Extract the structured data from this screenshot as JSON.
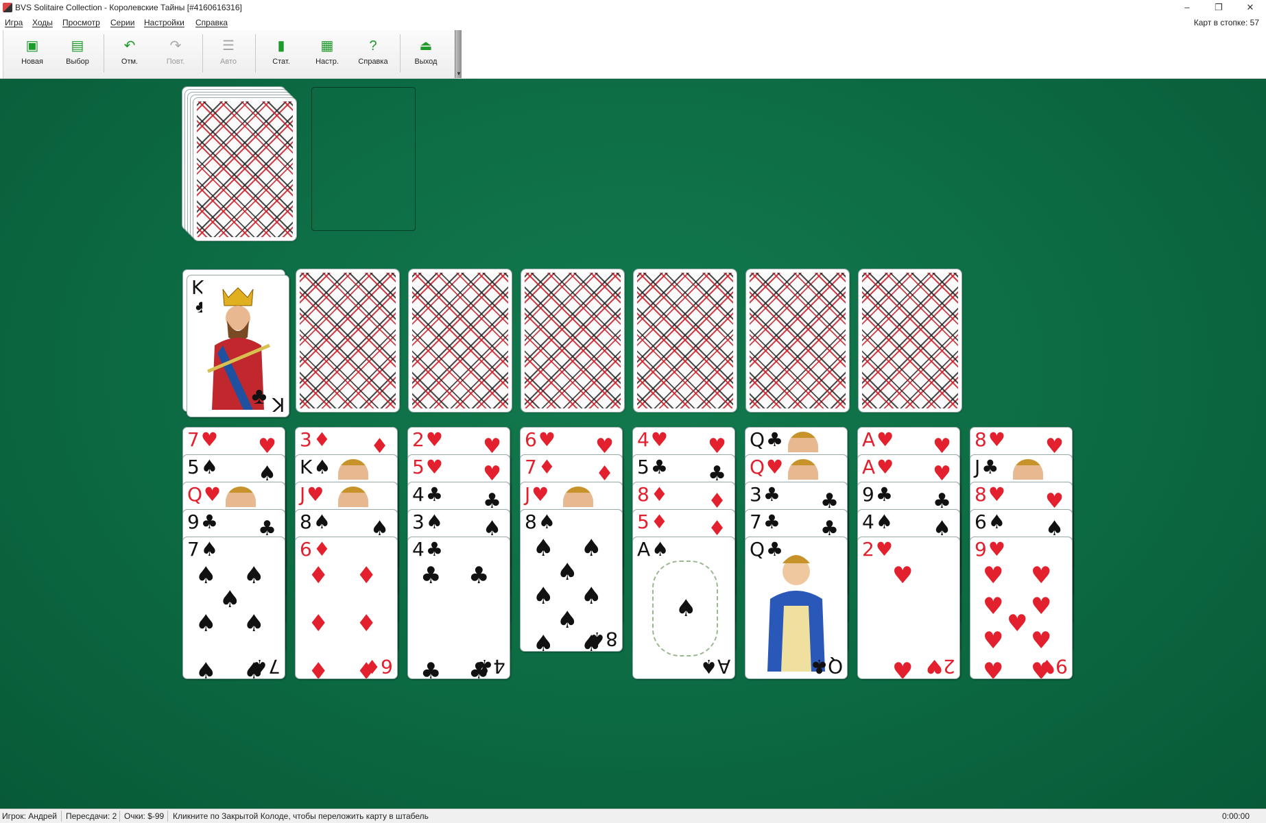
{
  "window": {
    "title": "BVS Solitaire Collection  -  Королевские Тайны [#4160616316]",
    "minimize": "–",
    "restore": "❐",
    "close": "✕"
  },
  "menu": {
    "items": [
      "Игра",
      "Ходы",
      "Просмотр",
      "Серии",
      "Настройки",
      "Справка"
    ],
    "stock_label": "Карт в стопке:  57"
  },
  "toolbar": {
    "new": "Новая",
    "choose": "Выбор",
    "undo": "Отм.",
    "redo": "Повт.",
    "auto": "Авто",
    "stats": "Стат.",
    "settings": "Настр.",
    "help": "Справка",
    "exit": "Выход"
  },
  "colors": {
    "felt": "#0e6a45",
    "red_suit": "#e2202e",
    "black_suit": "#111111",
    "icon_green": "#1e9a2a"
  },
  "board": {
    "reserve": {
      "rank": "K",
      "suit": "♣",
      "color": "black"
    },
    "tableau": [
      {
        "cards": [
          {
            "rank": "7",
            "suit": "♥",
            "color": "red"
          },
          {
            "rank": "5",
            "suit": "♠",
            "color": "black"
          },
          {
            "rank": "Q",
            "suit": "♥",
            "color": "red"
          },
          {
            "rank": "9",
            "suit": "♣",
            "color": "black"
          },
          {
            "rank": "7",
            "suit": "♠",
            "color": "black"
          }
        ]
      },
      {
        "cards": [
          {
            "rank": "3",
            "suit": "♦",
            "color": "red"
          },
          {
            "rank": "K",
            "suit": "♠",
            "color": "black"
          },
          {
            "rank": "J",
            "suit": "♥",
            "color": "red"
          },
          {
            "rank": "8",
            "suit": "♠",
            "color": "black"
          },
          {
            "rank": "6",
            "suit": "♦",
            "color": "red"
          }
        ]
      },
      {
        "cards": [
          {
            "rank": "2",
            "suit": "♥",
            "color": "red"
          },
          {
            "rank": "5",
            "suit": "♥",
            "color": "red"
          },
          {
            "rank": "4",
            "suit": "♣",
            "color": "black"
          },
          {
            "rank": "3",
            "suit": "♠",
            "color": "black"
          },
          {
            "rank": "4",
            "suit": "♣",
            "color": "black"
          }
        ]
      },
      {
        "cards": [
          {
            "rank": "6",
            "suit": "♥",
            "color": "red"
          },
          {
            "rank": "7",
            "suit": "♦",
            "color": "red"
          },
          {
            "rank": "J",
            "suit": "♥",
            "color": "red"
          },
          {
            "rank": "8",
            "suit": "♠",
            "color": "black"
          }
        ]
      },
      {
        "cards": [
          {
            "rank": "4",
            "suit": "♥",
            "color": "red"
          },
          {
            "rank": "5",
            "suit": "♣",
            "color": "black"
          },
          {
            "rank": "8",
            "suit": "♦",
            "color": "red"
          },
          {
            "rank": "5",
            "suit": "♦",
            "color": "red"
          },
          {
            "rank": "A",
            "suit": "♠",
            "color": "black"
          }
        ]
      },
      {
        "cards": [
          {
            "rank": "Q",
            "suit": "♣",
            "color": "black"
          },
          {
            "rank": "Q",
            "suit": "♥",
            "color": "red"
          },
          {
            "rank": "3",
            "suit": "♣",
            "color": "black"
          },
          {
            "rank": "7",
            "suit": "♣",
            "color": "black"
          },
          {
            "rank": "Q",
            "suit": "♣",
            "color": "black"
          }
        ]
      },
      {
        "cards": [
          {
            "rank": "A",
            "suit": "♥",
            "color": "red"
          },
          {
            "rank": "A",
            "suit": "♥",
            "color": "red"
          },
          {
            "rank": "9",
            "suit": "♣",
            "color": "black"
          },
          {
            "rank": "4",
            "suit": "♠",
            "color": "black"
          },
          {
            "rank": "2",
            "suit": "♥",
            "color": "red"
          }
        ]
      },
      {
        "cards": [
          {
            "rank": "8",
            "suit": "♥",
            "color": "red"
          },
          {
            "rank": "J",
            "suit": "♣",
            "color": "black"
          },
          {
            "rank": "8",
            "suit": "♥",
            "color": "red"
          },
          {
            "rank": "6",
            "suit": "♠",
            "color": "black"
          },
          {
            "rank": "9",
            "suit": "♥",
            "color": "red"
          }
        ]
      }
    ]
  },
  "status": {
    "player": "Игрок: Андрей",
    "redeals": "Пересдачи: 2",
    "score": "Очки: $-99",
    "hint": "Кликните по Закрытой Колоде, чтобы переложить карту в штабель",
    "timer": "0:00:00"
  }
}
